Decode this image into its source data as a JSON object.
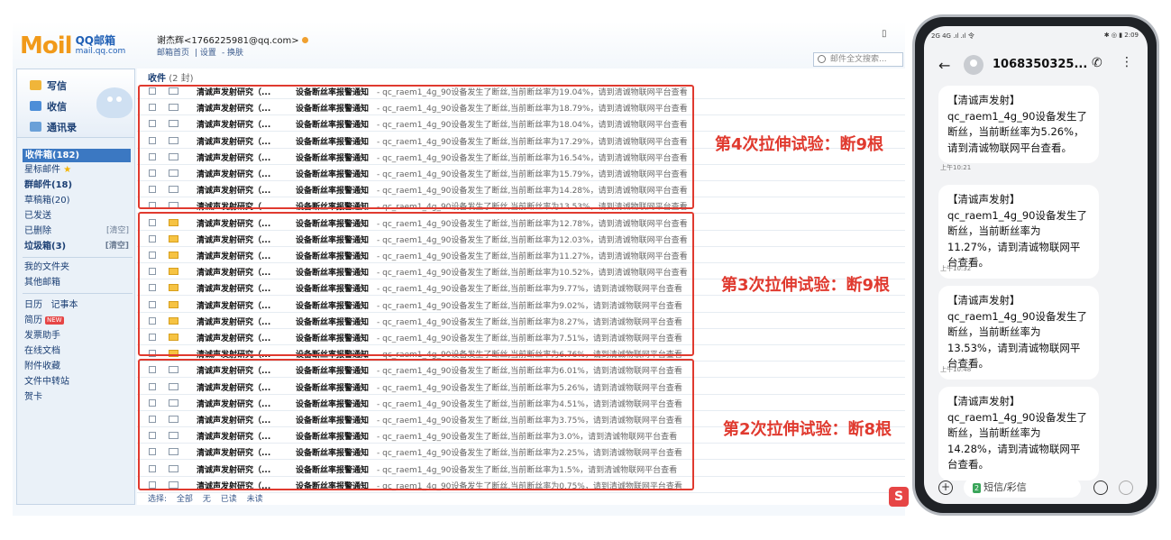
{
  "mail": {
    "logo_mark": "M",
    "logo_mark_accent": "oil",
    "logo_title": "QQ邮箱",
    "logo_domain": "mail.qq.com",
    "user": "谢杰辉<1766225981@qq.com>",
    "links": [
      "邮箱首页",
      "设置",
      "换肤"
    ],
    "search_placeholder": "邮件全文搜索...",
    "sidebar": {
      "write": "写信",
      "inbox_btn": "收信",
      "contacts": "通讯录",
      "folders": [
        {
          "label": "收件箱(182)",
          "aux": ""
        },
        {
          "label": "星标邮件",
          "aux": ""
        },
        {
          "label": "群邮件(18)",
          "aux": ""
        },
        {
          "label": "草稿箱(20)",
          "aux": ""
        },
        {
          "label": "已发送",
          "aux": ""
        },
        {
          "label": "已删除",
          "aux": "[清空]"
        },
        {
          "label": "垃圾箱(3)",
          "aux": "[清空]"
        }
      ],
      "my_folders": "我的文件夹",
      "other_mail": "其他邮箱",
      "tools": [
        "日历",
        "简历",
        "发票助手",
        "在线文档",
        "附件收藏",
        "文件中转站",
        "贺卡"
      ],
      "tool_notebook": "记事本",
      "new_badge": "NEW"
    },
    "list_title": "收件",
    "list_count": "(2 封)",
    "rows": [
      {
        "sender": "清诚声发射研究（...",
        "subject": "设备断丝率报警通知",
        "snippet": "- qc_raem1_4g_90设备发生了断丝,当前断丝率为19.04%，请到清诚物联网平台查看",
        "unread": false
      },
      {
        "sender": "清诚声发射研究（...",
        "subject": "设备断丝率报警通知",
        "snippet": "- qc_raem1_4g_90设备发生了断丝,当前断丝率为18.79%，请到清诚物联网平台查看",
        "unread": false
      },
      {
        "sender": "清诚声发射研究（...",
        "subject": "设备断丝率报警通知",
        "snippet": "- qc_raem1_4g_90设备发生了断丝,当前断丝率为18.04%，请到清诚物联网平台查看",
        "unread": false
      },
      {
        "sender": "清诚声发射研究（...",
        "subject": "设备断丝率报警通知",
        "snippet": "- qc_raem1_4g_90设备发生了断丝,当前断丝率为17.29%，请到清诚物联网平台查看",
        "unread": false
      },
      {
        "sender": "清诚声发射研究（...",
        "subject": "设备断丝率报警通知",
        "snippet": "- qc_raem1_4g_90设备发生了断丝,当前断丝率为16.54%，请到清诚物联网平台查看",
        "unread": false
      },
      {
        "sender": "清诚声发射研究（...",
        "subject": "设备断丝率报警通知",
        "snippet": "- qc_raem1_4g_90设备发生了断丝,当前断丝率为15.79%，请到清诚物联网平台查看",
        "unread": false
      },
      {
        "sender": "清诚声发射研究（...",
        "subject": "设备断丝率报警通知",
        "snippet": "- qc_raem1_4g_90设备发生了断丝,当前断丝率为14.28%，请到清诚物联网平台查看",
        "unread": false
      },
      {
        "sender": "清诚声发射研究（...",
        "subject": "设备断丝率报警通知",
        "snippet": "- qc_raem1_4g_90设备发生了断丝,当前断丝率为13.53%，请到清诚物联网平台查看",
        "unread": false
      },
      {
        "sender": "清诚声发射研究（...",
        "subject": "设备断丝率报警通知",
        "snippet": "- qc_raem1_4g_90设备发生了断丝,当前断丝率为12.78%，请到清诚物联网平台查看",
        "unread": true
      },
      {
        "sender": "清诚声发射研究（...",
        "subject": "设备断丝率报警通知",
        "snippet": "- qc_raem1_4g_90设备发生了断丝,当前断丝率为12.03%，请到清诚物联网平台查看",
        "unread": true
      },
      {
        "sender": "清诚声发射研究（...",
        "subject": "设备断丝率报警通知",
        "snippet": "- qc_raem1_4g_90设备发生了断丝,当前断丝率为11.27%，请到清诚物联网平台查看",
        "unread": true
      },
      {
        "sender": "清诚声发射研究（...",
        "subject": "设备断丝率报警通知",
        "snippet": "- qc_raem1_4g_90设备发生了断丝,当前断丝率为10.52%，请到清诚物联网平台查看",
        "unread": true
      },
      {
        "sender": "清诚声发射研究（...",
        "subject": "设备断丝率报警通知",
        "snippet": "- qc_raem1_4g_90设备发生了断丝,当前断丝率为9.77%，请到清诚物联网平台查看",
        "unread": true
      },
      {
        "sender": "清诚声发射研究（...",
        "subject": "设备断丝率报警通知",
        "snippet": "- qc_raem1_4g_90设备发生了断丝,当前断丝率为9.02%，请到清诚物联网平台查看",
        "unread": true
      },
      {
        "sender": "清诚声发射研究（...",
        "subject": "设备断丝率报警通知",
        "snippet": "- qc_raem1_4g_90设备发生了断丝,当前断丝率为8.27%，请到清诚物联网平台查看",
        "unread": true
      },
      {
        "sender": "清诚声发射研究（...",
        "subject": "设备断丝率报警通知",
        "snippet": "- qc_raem1_4g_90设备发生了断丝,当前断丝率为7.51%，请到清诚物联网平台查看",
        "unread": true
      },
      {
        "sender": "清诚声发射研究（...",
        "subject": "设备断丝率报警通知",
        "snippet": "- qc_raem1_4g_90设备发生了断丝,当前断丝率为6.76%，请到清诚物联网平台查看",
        "unread": true
      },
      {
        "sender": "清诚声发射研究（...",
        "subject": "设备断丝率报警通知",
        "snippet": "- qc_raem1_4g_90设备发生了断丝,当前断丝率为6.01%，请到清诚物联网平台查看",
        "unread": false
      },
      {
        "sender": "清诚声发射研究（...",
        "subject": "设备断丝率报警通知",
        "snippet": "- qc_raem1_4g_90设备发生了断丝,当前断丝率为5.26%，请到清诚物联网平台查看",
        "unread": false
      },
      {
        "sender": "清诚声发射研究（...",
        "subject": "设备断丝率报警通知",
        "snippet": "- qc_raem1_4g_90设备发生了断丝,当前断丝率为4.51%，请到清诚物联网平台查看",
        "unread": false
      },
      {
        "sender": "清诚声发射研究（...",
        "subject": "设备断丝率报警通知",
        "snippet": "- qc_raem1_4g_90设备发生了断丝,当前断丝率为3.75%，请到清诚物联网平台查看",
        "unread": false
      },
      {
        "sender": "清诚声发射研究（...",
        "subject": "设备断丝率报警通知",
        "snippet": "- qc_raem1_4g_90设备发生了断丝,当前断丝率为3.0%，请到清诚物联网平台查看",
        "unread": false
      },
      {
        "sender": "清诚声发射研究（...",
        "subject": "设备断丝率报警通知",
        "snippet": "- qc_raem1_4g_90设备发生了断丝,当前断丝率为2.25%，请到清诚物联网平台查看",
        "unread": false
      },
      {
        "sender": "清诚声发射研究（...",
        "subject": "设备断丝率报警通知",
        "snippet": "- qc_raem1_4g_90设备发生了断丝,当前断丝率为1.5%，请到清诚物联网平台查看",
        "unread": false
      },
      {
        "sender": "清诚声发射研究（...",
        "subject": "设备断丝率报警通知",
        "snippet": "- qc_raem1_4g_90设备发生了断丝,当前断丝率为0.75%，请到清诚物联网平台查看",
        "unread": false
      }
    ],
    "footer": [
      "选择:",
      "全部",
      "无",
      "已读",
      "未读"
    ]
  },
  "annotations": {
    "group4": "第4次拉伸试验：断9根",
    "group3": "第3次拉伸试验：断9根",
    "group2": "第2次拉伸试验：断8根"
  },
  "watermark": "S",
  "phone": {
    "status_left": "2G 4G .ıl .ıl 令",
    "status_right": "✱ ◎ ▮ 2:09",
    "contact": "1068350325...",
    "messages": [
      {
        "text": "【清诚声发射】qc_raem1_4g_90设备发生了断丝，当前断丝率为5.26%，请到清诚物联网平台查看。",
        "time": "上午10:21"
      },
      {
        "text": "【清诚声发射】qc_raem1_4g_90设备发生了断丝，当前断丝率为11.27%，请到清诚物联网平台查看。",
        "time": "上午10:32"
      },
      {
        "text": "【清诚声发射】qc_raem1_4g_90设备发生了断丝，当前断丝率为13.53%，请到清诚物联网平台查看。",
        "time": "上午10:48"
      },
      {
        "text": "【清诚声发射】qc_raem1_4g_90设备发生了断丝，当前断丝率为14.28%，请到清诚物联网平台查看。",
        "time": ""
      }
    ],
    "input_placeholder": "短信/彩信",
    "sim_badge": "2"
  }
}
